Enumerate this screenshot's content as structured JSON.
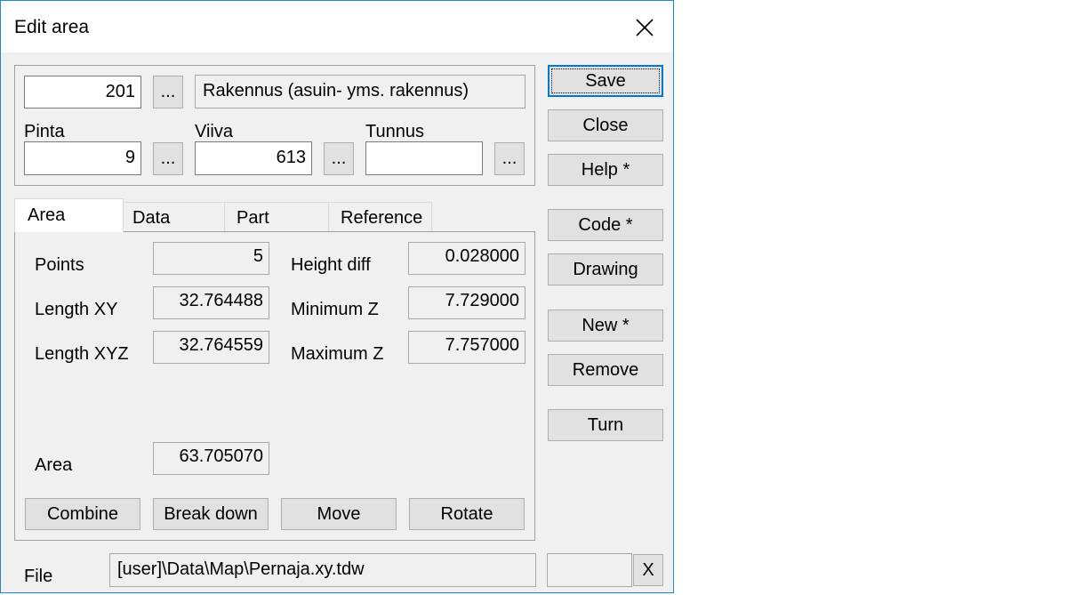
{
  "window": {
    "title": "Edit area"
  },
  "header": {
    "code_value": "201",
    "code_browse": "...",
    "code_description": "Rakennus (asuin- yms. rakennus)",
    "pinta_label": "Pinta",
    "pinta_value": "9",
    "pinta_browse": "...",
    "viiva_label": "Viiva",
    "viiva_value": "613",
    "viiva_browse": "...",
    "tunnus_label": "Tunnus",
    "tunnus_value": "",
    "tunnus_browse": "..."
  },
  "tabs": [
    {
      "label": "Area",
      "active": true
    },
    {
      "label": "Data",
      "active": false
    },
    {
      "label": "Part",
      "active": false
    },
    {
      "label": "Reference",
      "active": false
    }
  ],
  "area_tab": {
    "points_label": "Points",
    "points_value": "5",
    "length_xy_label": "Length XY",
    "length_xy_value": "32.764488",
    "length_xyz_label": "Length XYZ",
    "length_xyz_value": "32.764559",
    "height_diff_label": "Height diff",
    "height_diff_value": "0.028000",
    "min_z_label": "Minimum Z",
    "min_z_value": "7.729000",
    "max_z_label": "Maximum Z",
    "max_z_value": "7.757000",
    "area_label": "Area",
    "area_value": "63.705070",
    "buttons": {
      "combine": "Combine",
      "break_down": "Break down",
      "move": "Move",
      "rotate": "Rotate"
    }
  },
  "side_buttons": {
    "save": "Save",
    "close": "Close",
    "help": "Help *",
    "code": "Code *",
    "drawing": "Drawing",
    "new": "New *",
    "remove": "Remove",
    "turn": "Turn"
  },
  "footer": {
    "file_label": "File",
    "file_path": "[user]\\Data\\Map\\Pernaja.xy.tdw",
    "extra_value": "",
    "clear_button": "X"
  },
  "icons": {
    "close": "close-icon"
  },
  "colors": {
    "window_border": "#1f8ad2",
    "default_button_border": "#0078d7",
    "dialog_bg": "#f0f0f0"
  }
}
